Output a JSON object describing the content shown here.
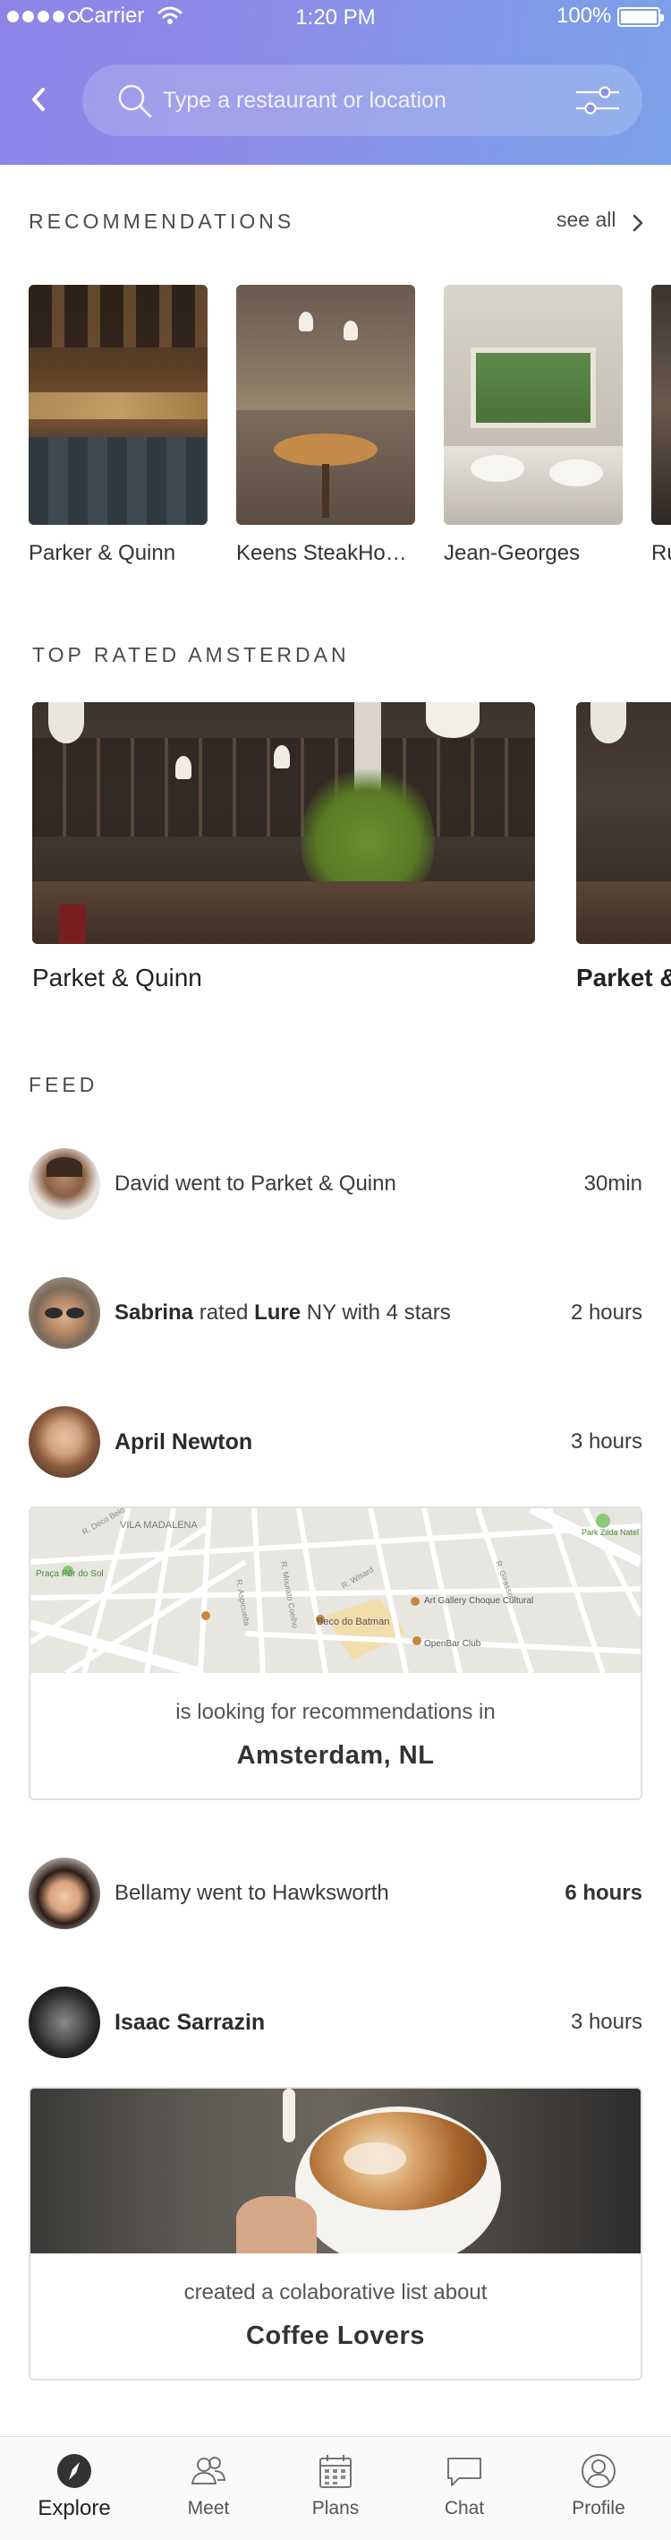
{
  "status_bar": {
    "carrier": "Carrier",
    "time": "1:20 PM",
    "battery": "100%"
  },
  "search": {
    "placeholder": "Type a restaurant or location"
  },
  "recommendations": {
    "title": "RECOMMENDATIONS",
    "see_all": "see all",
    "items": [
      {
        "label": "Parker & Quinn"
      },
      {
        "label": "Keens SteakHouse"
      },
      {
        "label": "Jean-Georges"
      },
      {
        "label": "Ru"
      }
    ]
  },
  "top_rated": {
    "title": "TOP RATED AMSTERDAN",
    "items": [
      {
        "label": "Parket & Quinn"
      },
      {
        "label": "Parket &"
      }
    ]
  },
  "feed": {
    "title": "FEED",
    "entries": [
      {
        "text": "David went to Parket & Quinn",
        "time": "30min"
      },
      {
        "name": "Sabrina",
        "rated_word": "rated",
        "place": "Lure",
        "rest": "NY with 4 stars",
        "time": "2 hours"
      },
      {
        "name": "April Newton",
        "time": "3 hours",
        "card": {
          "caption": "is looking for recommendations in",
          "title": "Amsterdam, NL",
          "map_labels": [
            "VILA MADALENA",
            "Praça Pôr do Sol",
            "Beco do Batman",
            "Art Gallery Choque Cultural",
            "OpenBar Club",
            "Park Zilda Natel",
            "R. Deco Belo",
            "R. Wisard",
            "R. Girassol",
            "R. Aspicuelta",
            "R. Mourato Coelho"
          ]
        }
      },
      {
        "text": "Bellamy went to Hawksworth",
        "time": "6 hours"
      },
      {
        "name": "Isaac Sarrazin",
        "time": "3 hours",
        "card": {
          "caption": "created a colaborative list about",
          "title": "Coffee Lovers"
        }
      }
    ]
  },
  "tabbar": {
    "tabs": [
      {
        "label": "Explore",
        "icon": "compass-icon",
        "active": true
      },
      {
        "label": "Meet",
        "icon": "people-icon"
      },
      {
        "label": "Plans",
        "icon": "calendar-icon"
      },
      {
        "label": "Chat",
        "icon": "chat-bubble-icon"
      },
      {
        "label": "Profile",
        "icon": "user-circle-icon"
      }
    ]
  },
  "colors": {
    "header_gradient_start": "#8e84e8",
    "header_gradient_end": "#7aa1e8",
    "text_primary": "#3a3a3a",
    "card_border": "#e1e1e1"
  }
}
